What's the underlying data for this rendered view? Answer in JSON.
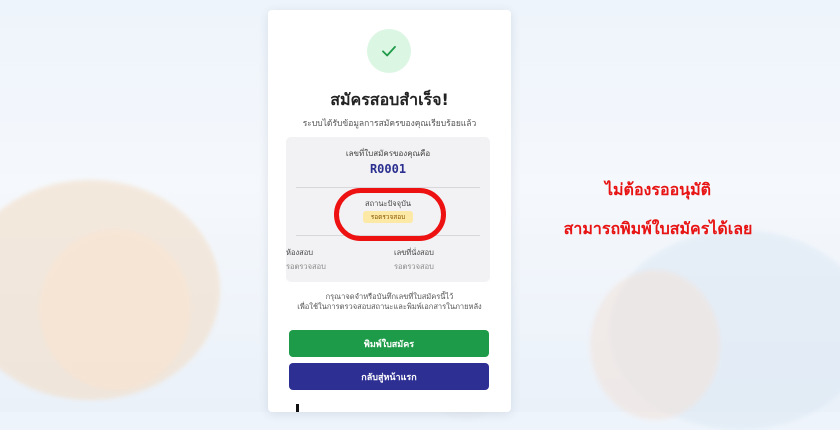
{
  "card": {
    "title": "สมัครสอบสำเร็จ!",
    "subtitle": "ระบบได้รับข้อมูลการสมัครของคุณเรียบร้อยแล้ว",
    "application_number_label": "เลขที่ใบสมัครของคุณคือ",
    "application_number": "R0001",
    "status_label": "สถานะปัจจุบัน",
    "status_value": "รอตรวจสอบ",
    "room_label": "ห้องสอบ",
    "room_value": "รอตรวจสอบ",
    "seat_label": "เลขที่นั่งสอบ",
    "seat_value": "รอตรวจสอบ",
    "notice_line1": "กรุณาจดจำหรือบันทึกเลขที่ใบสมัครนี้ไว้",
    "notice_line2": "เพื่อใช้ในการตรวจสอบสถานะและพิมพ์เอกสารในภายหลัง",
    "print_button": "พิมพ์ใบสมัคร",
    "home_button": "กลับสู่หน้าแรก"
  },
  "callout": {
    "line1": "ไม่ต้องรออนุมัติ",
    "line2": "สามารถพิมพ์ใบสมัครได้เลย"
  },
  "colors": {
    "success_green": "#1e9b48",
    "primary_indigo": "#2d2f93",
    "highlight_red": "#e81414",
    "status_badge_bg": "#fde9a6"
  },
  "icons": {
    "success": "check-icon"
  }
}
